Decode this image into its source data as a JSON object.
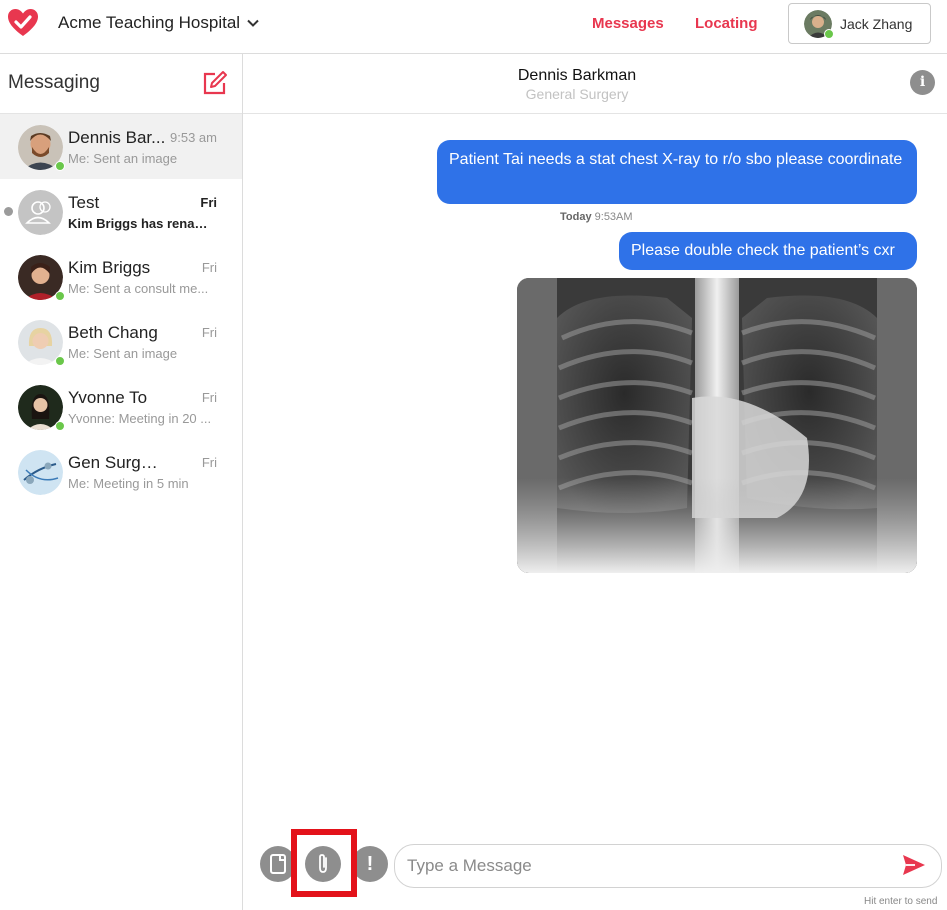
{
  "header": {
    "org_name": "Acme Teaching Hospital",
    "nav": {
      "messages": "Messages",
      "locating": "Locating"
    },
    "user": {
      "name": "Jack Zhang",
      "online": true
    },
    "accent_color": "#e8374f"
  },
  "sidebar": {
    "title": "Messaging",
    "conversations": [
      {
        "name": "Dennis Bar...",
        "time": "9:53 am",
        "preview": "Me: Sent an image",
        "active": true,
        "online": true,
        "unread": false
      },
      {
        "name": "Test",
        "time": "Fri",
        "preview": "Kim Briggs has renam...",
        "active": false,
        "online": false,
        "unread": true
      },
      {
        "name": "Kim Briggs",
        "time": "Fri",
        "preview": "Me: Sent a consult me...",
        "active": false,
        "online": true,
        "unread": false
      },
      {
        "name": "Beth Chang",
        "time": "Fri",
        "preview": "Me: Sent an image",
        "active": false,
        "online": true,
        "unread": false
      },
      {
        "name": "Yvonne To",
        "time": "Fri",
        "preview": "Yvonne: Meeting in 20 ...",
        "active": false,
        "online": true,
        "unread": false
      },
      {
        "name": "Gen Surgery Te...",
        "time": "Fri",
        "preview": "Me: Meeting in 5 min",
        "active": false,
        "online": false,
        "unread": false
      }
    ]
  },
  "chat": {
    "contact_name": "Dennis Barkman",
    "contact_department": "General Surgery",
    "info_icon": "i",
    "messages": [
      {
        "text": "Patient Tai needs a stat chest X-ray to r/o sbo please coordinate"
      },
      {
        "stamp_day": "Today",
        "stamp_time": "9:53AM"
      },
      {
        "text": "Please double check the patient’s cxr"
      },
      {
        "image": "chest-xray"
      }
    ],
    "bubble_color": "#2f72e8"
  },
  "composer": {
    "placeholder": "Type a Message",
    "alert_glyph": "!",
    "hint": "Hit enter to send",
    "highlighted_tool": "attach-button"
  }
}
